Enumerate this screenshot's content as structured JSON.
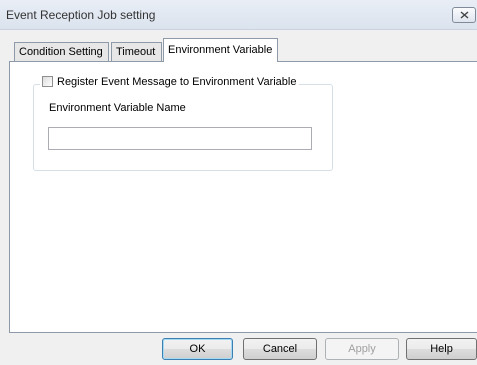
{
  "window": {
    "title": "Event Reception Job setting"
  },
  "tabs": [
    {
      "label": "Condition Setting",
      "active": false
    },
    {
      "label": "Timeout",
      "active": false
    },
    {
      "label": "Environment Variable",
      "active": true
    }
  ],
  "env_group": {
    "checkbox_label": "Register Event Message to Environment Variable",
    "checkbox_checked": false,
    "field_label": "Environment Variable Name",
    "field_value": "",
    "field_placeholder": ""
  },
  "buttons": {
    "ok": "OK",
    "cancel": "Cancel",
    "apply": "Apply",
    "help": "Help"
  },
  "icons": {
    "close": "close-icon"
  }
}
